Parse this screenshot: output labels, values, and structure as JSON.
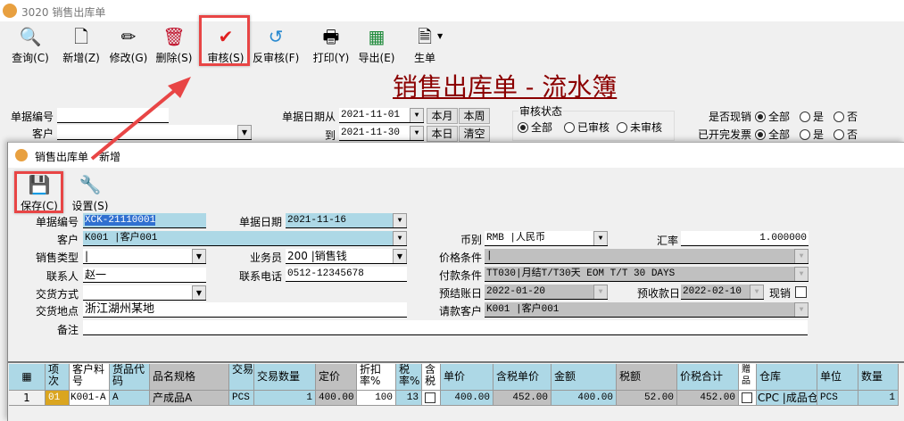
{
  "outer": {
    "title": "3020 销售出库单",
    "toolbar": [
      {
        "label": "查询(C)",
        "icon": "magnifier-icon"
      },
      {
        "label": "新增(Z)",
        "icon": "new-document-icon"
      },
      {
        "label": "修改(G)",
        "icon": "edit-pencil-icon"
      },
      {
        "label": "删除(S)",
        "icon": "trash-icon"
      },
      {
        "label": "审核(S)",
        "icon": "clipboard-check-icon"
      },
      {
        "label": "反审核(F)",
        "icon": "clipboard-undo-icon"
      },
      {
        "label": "打印(Y)",
        "icon": "printer-icon"
      },
      {
        "label": "导出(E)",
        "icon": "excel-icon"
      },
      {
        "label": "生单",
        "icon": "generate-document-icon"
      }
    ],
    "report_title": "销售出库单 - 流水簿",
    "filters": {
      "doc_no_label": "单据编号",
      "doc_no": "",
      "customer_label": "客户",
      "customer": "",
      "date_from_label": "单据日期从",
      "date_from": "2021-11-01",
      "date_to_label": "到",
      "date_to": "2021-11-30",
      "btn_month": "本月",
      "btn_week": "本周",
      "btn_day": "本日",
      "btn_clear": "清空",
      "audit_group": "审核状态",
      "audit_options": [
        "全部",
        "已审核",
        "未审核"
      ],
      "audit_selected": "全部",
      "cash_label": "是否现销",
      "invoice_label": "已开完发票",
      "yn_options": [
        "全部",
        "是",
        "否"
      ],
      "cash_selected": "全部",
      "invoice_selected": "全部"
    }
  },
  "inner": {
    "title": "销售出库单 - 新增",
    "toolbar": [
      {
        "label": "保存(C)",
        "icon": "save-floppy-icon"
      },
      {
        "label": "设置(S)",
        "icon": "settings-tools-icon"
      }
    ],
    "form": {
      "doc_no_label": "单据编号",
      "doc_no": "XCK-21110001",
      "doc_date_label": "单据日期",
      "doc_date": "2021-11-16",
      "customer_label": "客户",
      "customer": "K001 |客户001",
      "sales_type_label": "销售类型",
      "sales_type": "|",
      "salesman_label": "业务员",
      "salesman": "200 |销售钱",
      "contact_label": "联系人",
      "contact": "赵一",
      "phone_label": "联系电话",
      "phone": "0512-12345678",
      "delivery_method_label": "交货方式",
      "delivery_method": "",
      "delivery_place_label": "交货地点",
      "delivery_place": "浙江湖州某地",
      "remark_label": "备注",
      "remark": "",
      "currency_label": "币别",
      "currency": "RMB |人民币",
      "rate_label": "汇率",
      "rate": "1.000000",
      "price_terms_label": "价格条件",
      "price_terms": "|",
      "payment_terms_label": "付款条件",
      "payment_terms": "TT030|月结T/T30天 EOM T/T 30 DAYS",
      "settle_date_label": "预结账日",
      "settle_date": "2022-01-20",
      "receipt_date_label": "预收款日",
      "receipt_date": "2022-02-10",
      "cash_sale_label": "现销",
      "cash_sale": false,
      "bill_customer_label": "请款客户",
      "bill_customer": "K001 |客户001"
    },
    "grid": {
      "headers": [
        "项次",
        "客户料号",
        "货品代码",
        "品名规格",
        "交易",
        "交易数量",
        "定价",
        "折扣率%",
        "税率%",
        "含税",
        "单价",
        "含税单价",
        "金额",
        "税额",
        "价税合计",
        "赠品",
        "仓库",
        "单位",
        "数量"
      ],
      "rows": [
        {
          "index": "1",
          "item": "01",
          "cust_part": "K001-A",
          "code": "A",
          "name": "产成品A",
          "unit": "PCS",
          "qty": "1",
          "list_price": "400.00",
          "discount": "100",
          "tax_rate": "13",
          "tax_incl": false,
          "price": "400.00",
          "price_tax": "452.00",
          "amount": "400.00",
          "tax": "52.00",
          "total": "452.00",
          "gift": false,
          "warehouse": "CPC |成品仓",
          "unit2": "PCS",
          "qty2": "1"
        }
      ]
    }
  },
  "colors": {
    "title_red": "#8b0000",
    "highlight": "#e84545",
    "field_blue": "#add8e6",
    "disabled_gray": "#c0c0c0",
    "item_gold": "#daa520"
  }
}
